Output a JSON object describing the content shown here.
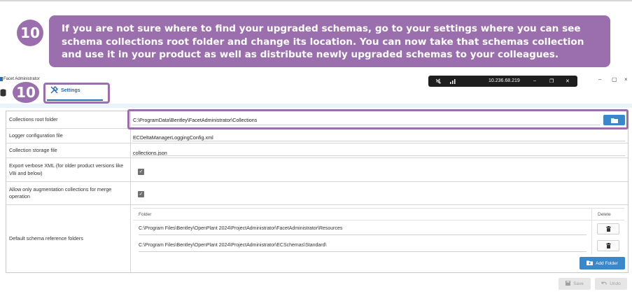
{
  "callout": {
    "step": "10",
    "text": "If you are not sure where to find your upgraded schemas, go to your settings where you can see schema collections root folder and change its location. You can now take that schemas collection and use it in your product as well as distribute newly upgraded schemas to your colleagues."
  },
  "window": {
    "title": "Facet Administrator",
    "controls": {
      "minimize": "–",
      "maximize": "▢",
      "close": "×"
    }
  },
  "remote_bar": {
    "ip": "10.236.68.219",
    "minimize": "–",
    "restore": "❐",
    "close": "✕"
  },
  "tab": {
    "step": "10",
    "label": "Settings"
  },
  "settings": {
    "collections_root": {
      "label": "Collections root folder",
      "value": "C:\\ProgramData\\Bentley\\FacetAdministrator\\Collections"
    },
    "logger_config": {
      "label": "Logger configuration file",
      "value": "ECDeltaManagerLoggingConfig.xml"
    },
    "collection_storage": {
      "label": "Collection storage file",
      "value": "collections.json"
    },
    "export_verbose": {
      "label": "Export verbose XML (for older product versions like V8i and below)",
      "checked": true
    },
    "allow_augmentation": {
      "label": "Allow only augmentation collections for merge operation",
      "checked": true
    },
    "schema_refs": {
      "label": "Default schema reference folders",
      "col_folder": "Folder",
      "col_delete": "Delete",
      "rows": [
        "C:\\Program Files\\Bentley\\OpenPlant 2024\\ProjectAdministrator\\FacetAdministrator\\Resources",
        "C:\\Program Files\\Bentley\\OpenPlant 2024\\ProjectAdministrator\\ECSchemas\\Standard\\"
      ],
      "add_folder": "Add Folder"
    }
  },
  "footer": {
    "save": "Save",
    "undo": "Undo"
  },
  "colors": {
    "accent_purple": "#9b6fae",
    "primary_blue": "#3a87c9"
  }
}
